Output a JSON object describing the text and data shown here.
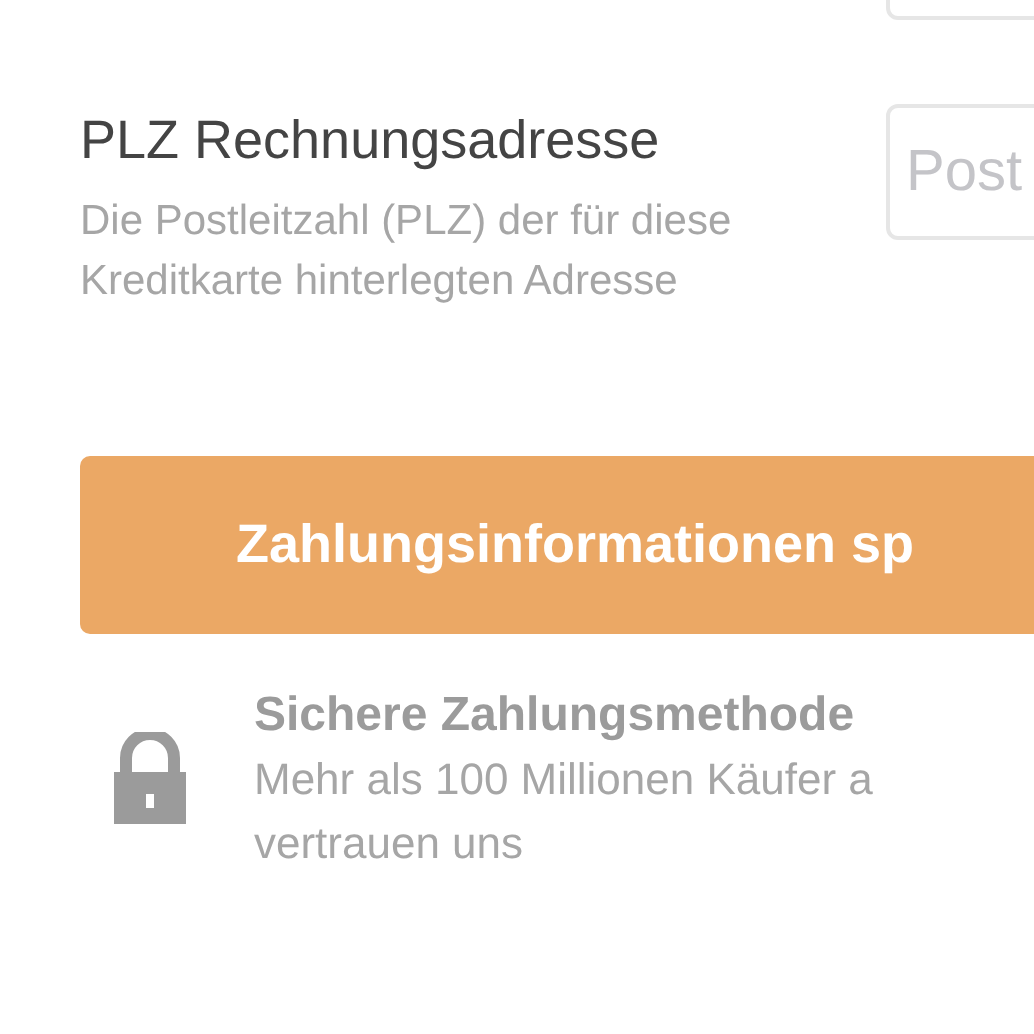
{
  "postal_code_field": {
    "label": "PLZ Rechnungsadresse",
    "description": "Die Postleitzahl (PLZ) der für diese Kreditkarte hinterlegten Adresse",
    "placeholder": "Post"
  },
  "submit_button": {
    "label": "Zahlungsinformationen sp"
  },
  "security_note": {
    "title": "Sichere Zahlungsmethode",
    "text": "Mehr als 100 Millionen Käufer a vertrauen uns"
  }
}
